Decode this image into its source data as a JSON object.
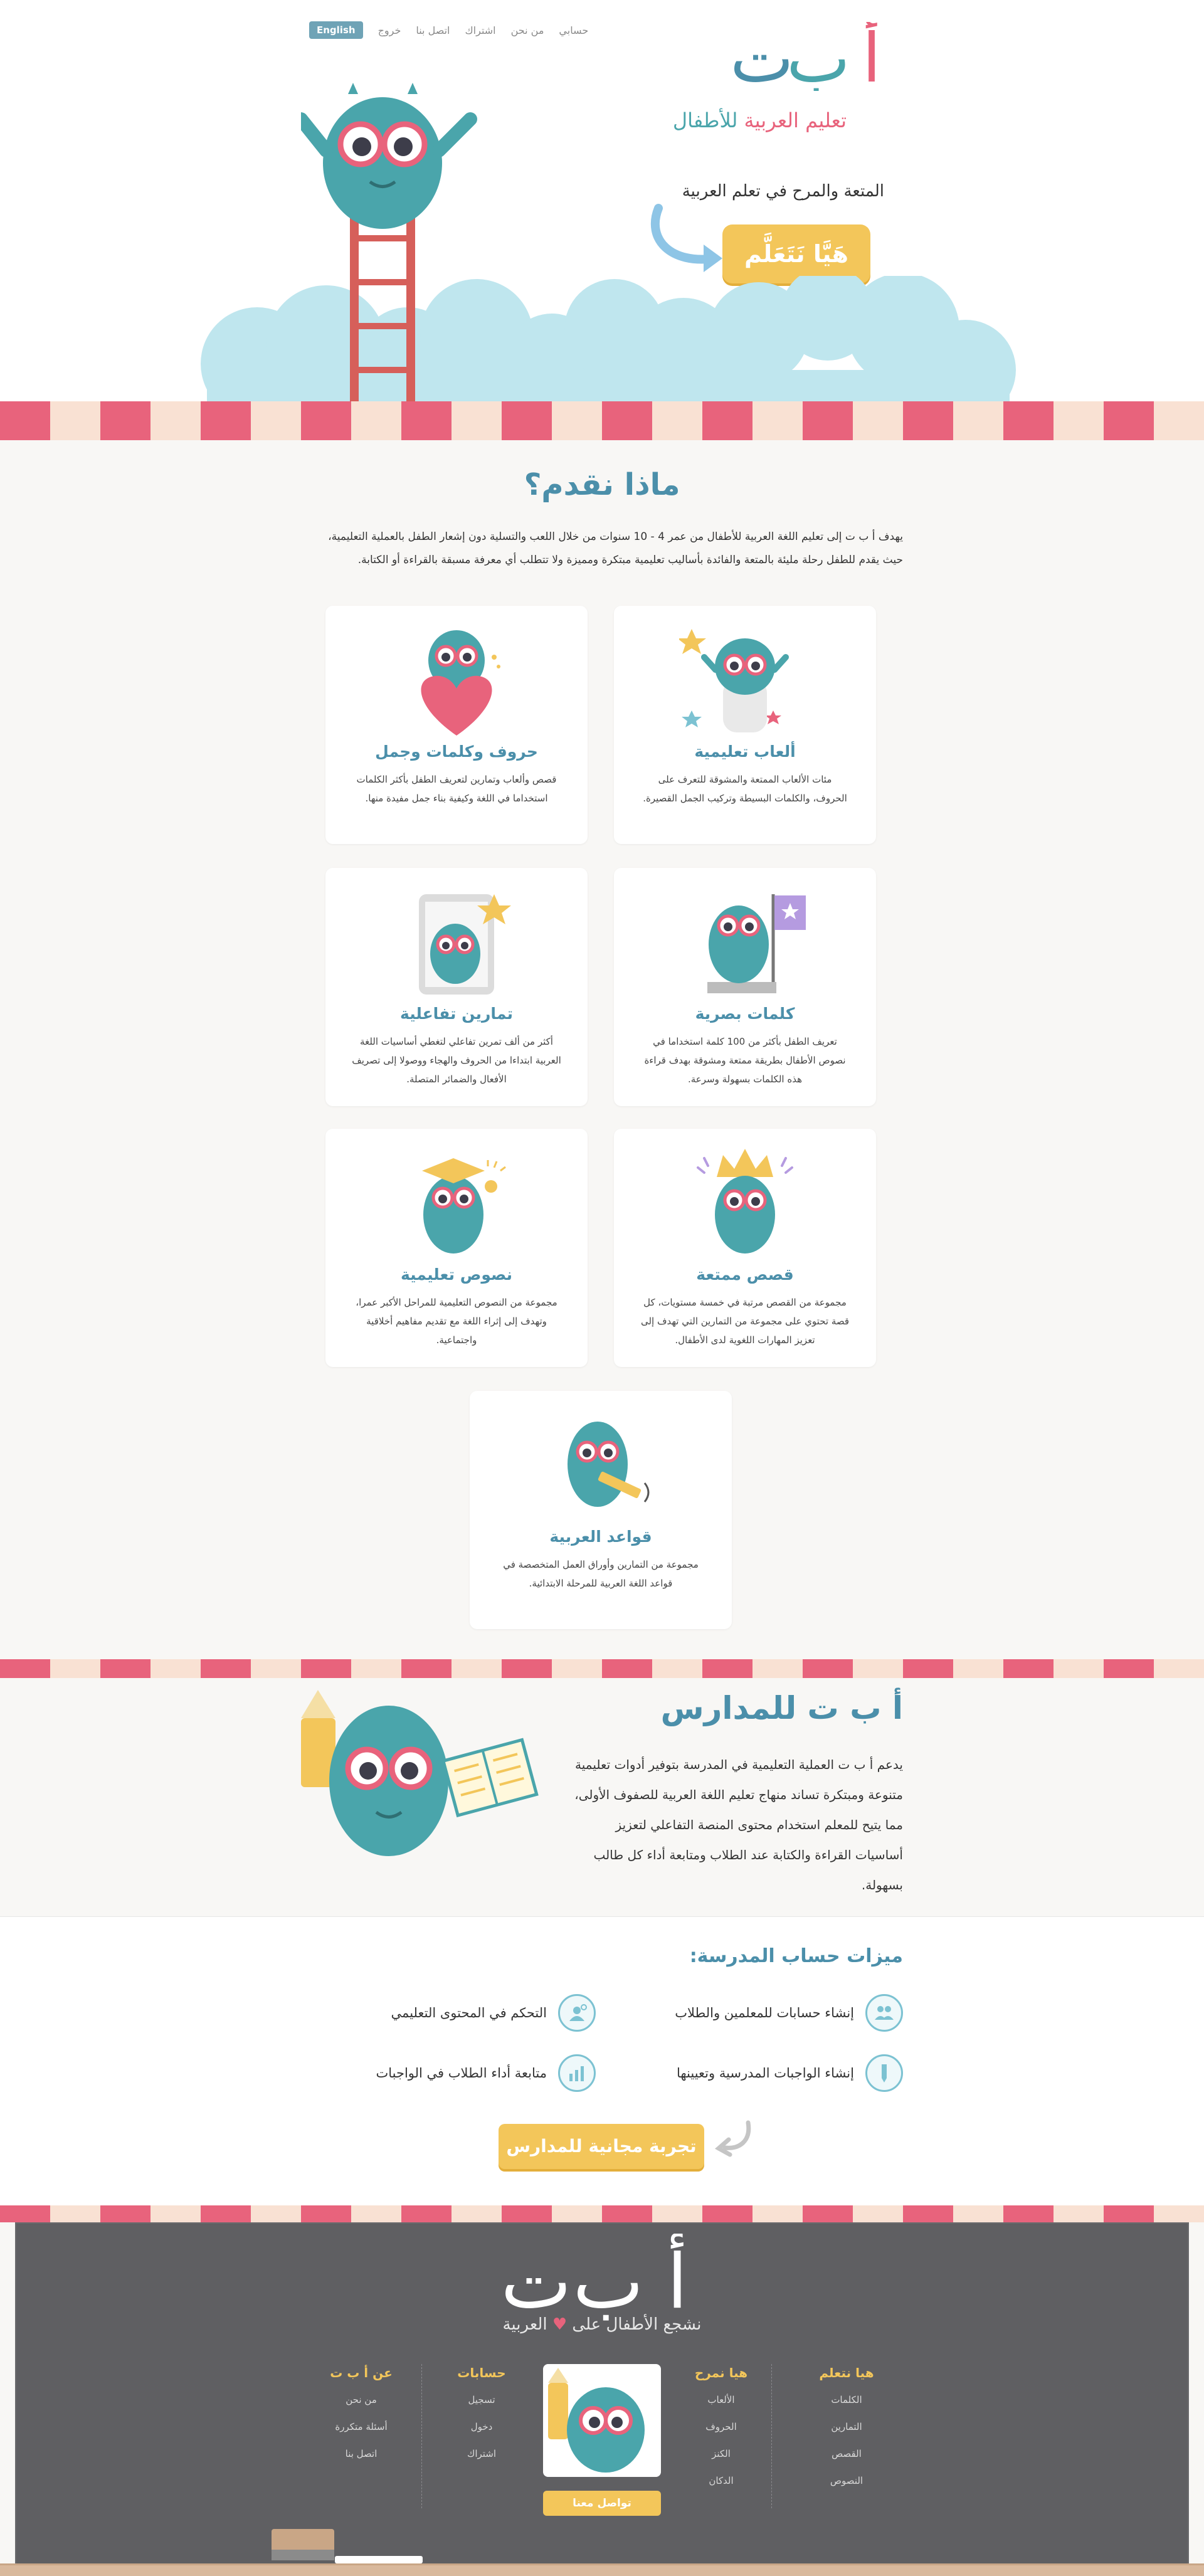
{
  "nav": {
    "english": "English",
    "logout": "خروج",
    "contact": "اتصل بنا",
    "subscribe": "اشتراك",
    "about": "من نحن",
    "account": "حسابي"
  },
  "brand": {
    "logo_letters": [
      "أ",
      "ب",
      "ت"
    ],
    "tagline_1": "تعليم العربية",
    "tagline_2": "للأطفال"
  },
  "hero": {
    "subtitle": "المتعة والمرح في تعلم العربية",
    "cta": "هَيَّا نَتَعَلَّم"
  },
  "offer": {
    "title": "ماذا نقدم؟",
    "intro": "يهدف أ ب ت إلى تعليم اللغة العربية للأطفال من عمر 4 - 10 سنوات من خلال اللعب والتسلية دون إشعار الطفل بالعملية التعليمية، حيث يقدم للطفل رحلة مليئة بالمتعة والفائدة بأساليب تعليمية مبتكرة ومميزة ولا تتطلب أي معرفة مسبقة بالقراءة أو الكتابة.",
    "cards": [
      {
        "title": "ألعاب تعليمية",
        "text": "مئات الألعاب الممتعة والمشوقة للتعرف على الحروف، والكلمات البسيطة وتركيب الجمل القصيرة."
      },
      {
        "title": "حروف وكلمات وجمل",
        "text": "قصص وألعاب وتمارين لتعريف الطفل بأكثر الكلمات استخداما في اللغة وكيفية بناء جمل مفيدة منها."
      },
      {
        "title": "كلمات بصرية",
        "text": "تعريف الطفل بأكثر من 100 كلمة استخداما في نصوص الأطفال بطريقة ممتعة ومشوقة بهدف قراءة هذه الكلمات بسهولة وسرعة."
      },
      {
        "title": "تمارين تفاعلية",
        "text": "أكثر من ألف تمرين تفاعلي لتغطي أساسيات اللغة العربية ابتداءا من الحروف والهجاء ووصولا إلى تصريف الأفعال والضمائر المتصلة."
      },
      {
        "title": "قصص ممتعة",
        "text": "مجموعة من القصص مرتبة في خمسة مستويات، كل قصة تحتوي على مجموعة من التمارين التي تهدف إلى تعزيز المهارات اللغوية لدى الأطفال."
      },
      {
        "title": "نصوص تعليمية",
        "text": "مجموعة من النصوص التعليمية للمراحل الأكبر عمرا، وتهدف إلى إثراء اللغة مع تقديم مفاهيم أخلاقية واجتماعية."
      },
      {
        "title": "قواعد العربية",
        "text": "مجموعة من التمارين وأوراق العمل المتخصصة في قواعد اللغة العربية للمرحلة الابتدائية."
      }
    ]
  },
  "schools": {
    "title": "أ ب ت للمدارس",
    "text": "يدعم أ ب ت العملية التعليمية في المدرسة بتوفير أدوات تعليمية متنوعة ومبتكرة تساند منهاج تعليم اللغة العربية للصفوف الأولى، مما يتيح للمعلم استخدام محتوى المنصة التفاعلي لتعزيز أساسيات القراءة والكتابة عند الطلاب ومتابعة أداء كل طالب بسهولة.",
    "features_title": "ميزات حساب المدرسة:",
    "features": [
      {
        "text": "إنشاء حسابات للمعلمين والطلاب",
        "icon": "users-icon"
      },
      {
        "text": "التحكم في المحتوى التعليمي",
        "icon": "content-control-icon"
      },
      {
        "text": "إنشاء الواجبات المدرسية وتعيينها",
        "icon": "pencil-icon"
      },
      {
        "text": "متابعة أداء الطلاب في الواجبات",
        "icon": "chart-icon"
      }
    ],
    "cta": "تجربة مجانية للمدارس"
  },
  "footer": {
    "logo_letters": [
      "أ",
      "ب",
      "ت"
    ],
    "tagline_pre": "نشجع الأطفال على",
    "tagline_post": "العربية",
    "columns": [
      {
        "title": "هيا نتعلم",
        "links": [
          "الكلمات",
          "التمارين",
          "القصص",
          "النصوص"
        ]
      },
      {
        "title": "هيا نمرح",
        "links": [
          "الألعاب",
          "الحروف",
          "الكنز",
          "الدكان"
        ]
      },
      {
        "title": "حسابات",
        "links": [
          "تسجيل",
          "دخول",
          "اشتراك"
        ]
      },
      {
        "title": "عن أ ب ت",
        "links": [
          "من نحن",
          "أسئلة متكررة",
          "اتصل بنا"
        ]
      }
    ],
    "contact_btn": "تواصل معنا"
  },
  "colors": {
    "brand_blue": "#4b8faa",
    "brand_pink": "#e8637c",
    "brand_teal": "#4aa5ab",
    "cta_yellow": "#f3c65a",
    "chalkboard": "#5f5f62"
  }
}
